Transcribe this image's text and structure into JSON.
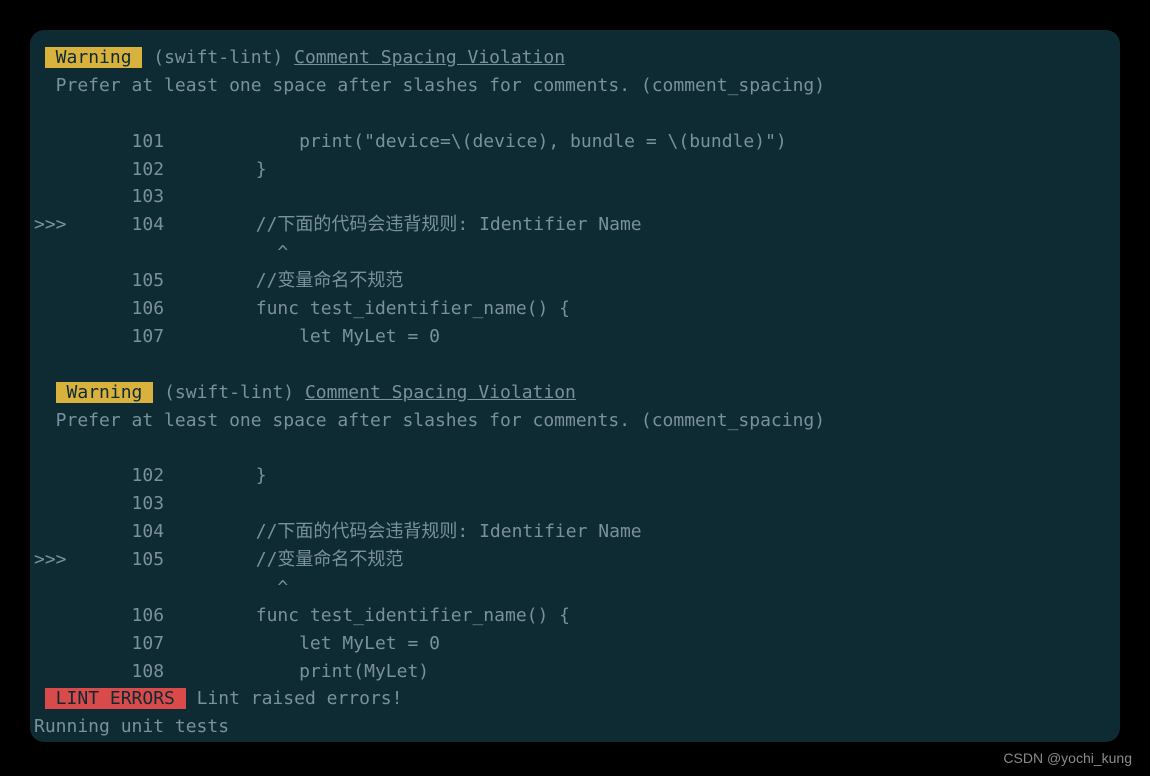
{
  "warnings": [
    {
      "badge": " Warning ",
      "linter": " (swift-lint) ",
      "rule": "Comment Spacing Violation",
      "message": "  Prefer at least one space after slashes for comments. (comment_spacing)",
      "code_lines": [
        {
          "gutter": "         ",
          "lineno": "101",
          "code": "         print(\"device=\\(device), bundle = \\(bundle)\")"
        },
        {
          "gutter": "         ",
          "lineno": "102",
          "code": "     }"
        },
        {
          "gutter": "         ",
          "lineno": "103",
          "code": ""
        },
        {
          "gutter": ">>>      ",
          "lineno": "104",
          "code": "     //下面的代码会违背规则: Identifier Name"
        },
        {
          "gutter": "         ",
          "lineno": "   ",
          "code": "       ^"
        },
        {
          "gutter": "         ",
          "lineno": "105",
          "code": "     //变量命名不规范"
        },
        {
          "gutter": "         ",
          "lineno": "106",
          "code": "     func test_identifier_name() {"
        },
        {
          "gutter": "         ",
          "lineno": "107",
          "code": "         let MyLet = 0"
        }
      ]
    },
    {
      "badge": " Warning ",
      "linter": " (swift-lint) ",
      "rule": "Comment Spacing Violation",
      "message": "  Prefer at least one space after slashes for comments. (comment_spacing)",
      "code_lines": [
        {
          "gutter": "         ",
          "lineno": "102",
          "code": "     }"
        },
        {
          "gutter": "         ",
          "lineno": "103",
          "code": ""
        },
        {
          "gutter": "         ",
          "lineno": "104",
          "code": "     //下面的代码会违背规则: Identifier Name"
        },
        {
          "gutter": ">>>      ",
          "lineno": "105",
          "code": "     //变量命名不规范"
        },
        {
          "gutter": "         ",
          "lineno": "   ",
          "code": "       ^"
        },
        {
          "gutter": "         ",
          "lineno": "106",
          "code": "     func test_identifier_name() {"
        },
        {
          "gutter": "         ",
          "lineno": "107",
          "code": "         let MyLet = 0"
        },
        {
          "gutter": "         ",
          "lineno": "108",
          "code": "         print(MyLet)"
        }
      ]
    }
  ],
  "error": {
    "badge": " LINT ERRORS ",
    "message": " Lint raised errors!"
  },
  "running": "Running unit tests",
  "watermark": "CSDN @yochi_kung"
}
